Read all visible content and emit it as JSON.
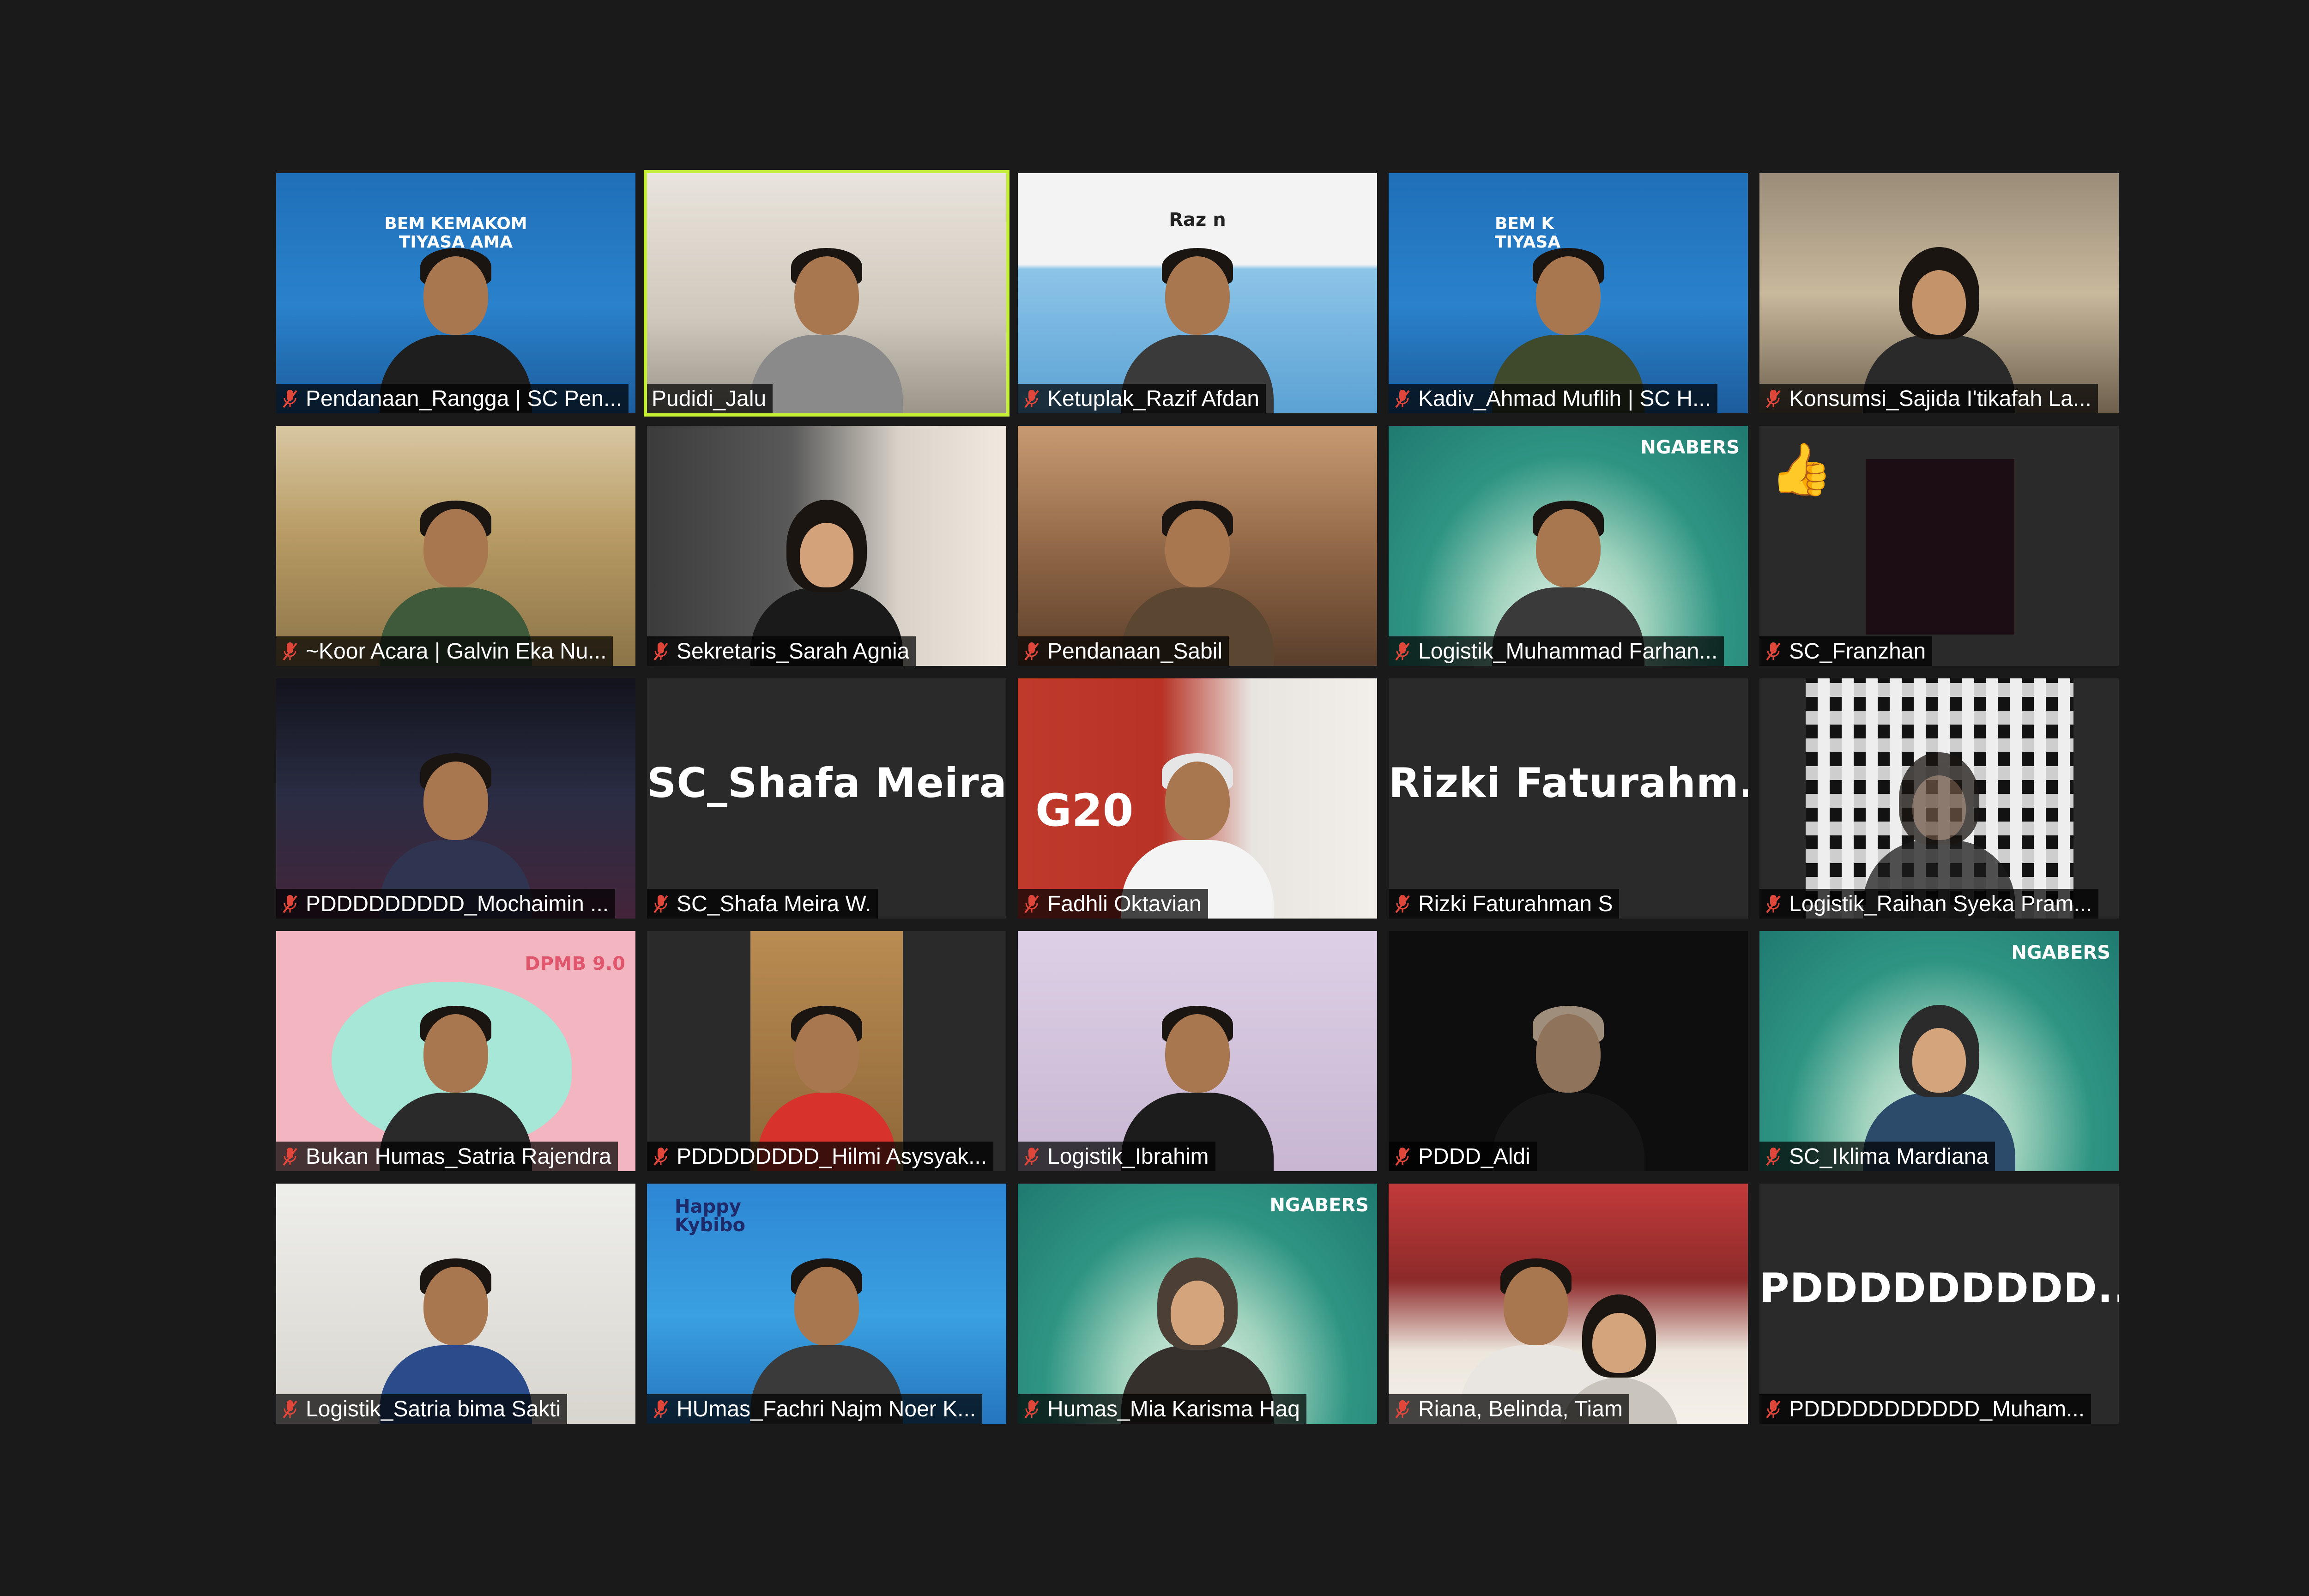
{
  "meeting": {
    "participants": [
      {
        "name": "Pendanaan_Rangga | SC Pen...",
        "muted": true,
        "video": "camera",
        "banner": "BEM KEMAKOM\nTIYASA AMA",
        "active": false
      },
      {
        "name": "Pudidi_Jalu",
        "muted": false,
        "video": "camera",
        "active": true
      },
      {
        "name": "Ketuplak_Razif Afdan",
        "muted": true,
        "video": "camera",
        "banner": "Raz n",
        "active": false
      },
      {
        "name": "Kadiv_Ahmad Muflih | SC H...",
        "muted": true,
        "video": "camera",
        "banner": "BEM K\nTIYASA",
        "active": false
      },
      {
        "name": "Konsumsi_Sajida I'tikafah La...",
        "muted": true,
        "video": "camera",
        "active": false
      },
      {
        "name": "~Koor Acara | Galvin Eka Nu...",
        "muted": true,
        "video": "camera",
        "active": false
      },
      {
        "name": "Sekretaris_Sarah Agnia",
        "muted": true,
        "video": "camera",
        "active": false
      },
      {
        "name": "Pendanaan_Sabil",
        "muted": true,
        "video": "camera",
        "active": false
      },
      {
        "name": "Logistik_Muhammad Farhan...",
        "muted": true,
        "video": "camera",
        "banner": "NGABERS",
        "active": false
      },
      {
        "name": "SC_Franzhan",
        "muted": true,
        "video": "off-reaction",
        "reaction": "👍",
        "active": false
      },
      {
        "name": "PDDDDDDDDD_Mochaimin ...",
        "muted": true,
        "video": "camera",
        "active": false
      },
      {
        "name": "SC_Shafa Meira W.",
        "muted": true,
        "video": "off",
        "display": "SC_Shafa  Meira...",
        "active": false
      },
      {
        "name": "Fadhli Oktavian",
        "muted": true,
        "video": "camera",
        "banner": "G20",
        "active": false
      },
      {
        "name": "Rizki Faturahman S",
        "muted": true,
        "video": "off",
        "display": "Rizki  Faturahm...",
        "active": false
      },
      {
        "name": "Logistik_Raihan Syeka Pram...",
        "muted": true,
        "video": "camera-qr",
        "active": false
      },
      {
        "name": "Bukan Humas_Satria Rajendra",
        "muted": true,
        "video": "camera",
        "banner": "DPMB 9.0",
        "active": false
      },
      {
        "name": "PDDDDDDDD_Hilmi Asysyak...",
        "muted": true,
        "video": "camera",
        "active": false
      },
      {
        "name": "Logistik_Ibrahim",
        "muted": true,
        "video": "camera",
        "active": false
      },
      {
        "name": "PDDD_Aldi",
        "muted": true,
        "video": "camera",
        "active": false
      },
      {
        "name": "SC_Iklima Mardiana",
        "muted": true,
        "video": "camera",
        "banner": "NGABERS",
        "active": false
      },
      {
        "name": "Logistik_Satria bima Sakti",
        "muted": true,
        "video": "camera",
        "active": false
      },
      {
        "name": "HUmas_Fachri Najm Noer K...",
        "muted": true,
        "video": "camera",
        "banner": "Happy\nKybibo",
        "active": false
      },
      {
        "name": "Humas_Mia Karisma Haq",
        "muted": true,
        "video": "camera",
        "banner": "NGABERS",
        "active": false
      },
      {
        "name": "Riana, Belinda, Tiam",
        "muted": true,
        "video": "camera",
        "active": false
      },
      {
        "name": "PDDDDDDDDDDD_Muham...",
        "muted": true,
        "video": "off",
        "display": "PDDDDDDDDD...",
        "active": false
      }
    ]
  },
  "colors": {
    "background": "#1a1a1a",
    "tile_off": "#242424",
    "active_speaker_border": "#c6f038",
    "muted_icon": "#e0463a"
  }
}
